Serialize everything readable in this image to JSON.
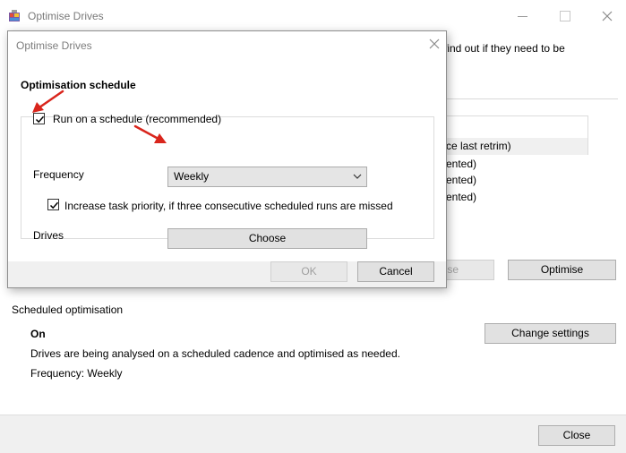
{
  "main_window": {
    "title": "Optimise Drives",
    "intro_text_visible": "find out if they need to be",
    "drive_rows": [
      "ce last retrim)",
      "ented)",
      "ented)",
      "ented)"
    ],
    "analyse_button_partial": "se",
    "optimise_button": "Optimise",
    "scheduled_section_label": "Scheduled optimisation",
    "status_on": "On",
    "status_description": "Drives are being analysed on a scheduled cadence and optimised as needed.",
    "status_frequency": "Frequency: Weekly",
    "change_settings_button": "Change settings",
    "close_button": "Close"
  },
  "dialog": {
    "title": "Optimise Drives",
    "heading": "Optimisation schedule",
    "run_on_schedule_label": "Run on a schedule (recommended)",
    "run_on_schedule_checked": true,
    "frequency_label": "Frequency",
    "frequency_value": "Weekly",
    "increase_priority_label": "Increase task priority, if three consecutive scheduled runs are missed",
    "increase_priority_checked": true,
    "drives_label": "Drives",
    "choose_button": "Choose",
    "ok_button": "OK",
    "cancel_button": "Cancel"
  },
  "colors": {
    "annotation_arrow": "#d9251c",
    "selected_row": "#f0f0f0",
    "button_face": "#e1e1e1",
    "footer": "#f0f0f0"
  },
  "icons": [
    "app-defrag-icon",
    "minimize-icon",
    "maximize-icon",
    "close-icon",
    "checkmark-icon",
    "chevron-down-icon",
    "red-arrow-annotation"
  ]
}
